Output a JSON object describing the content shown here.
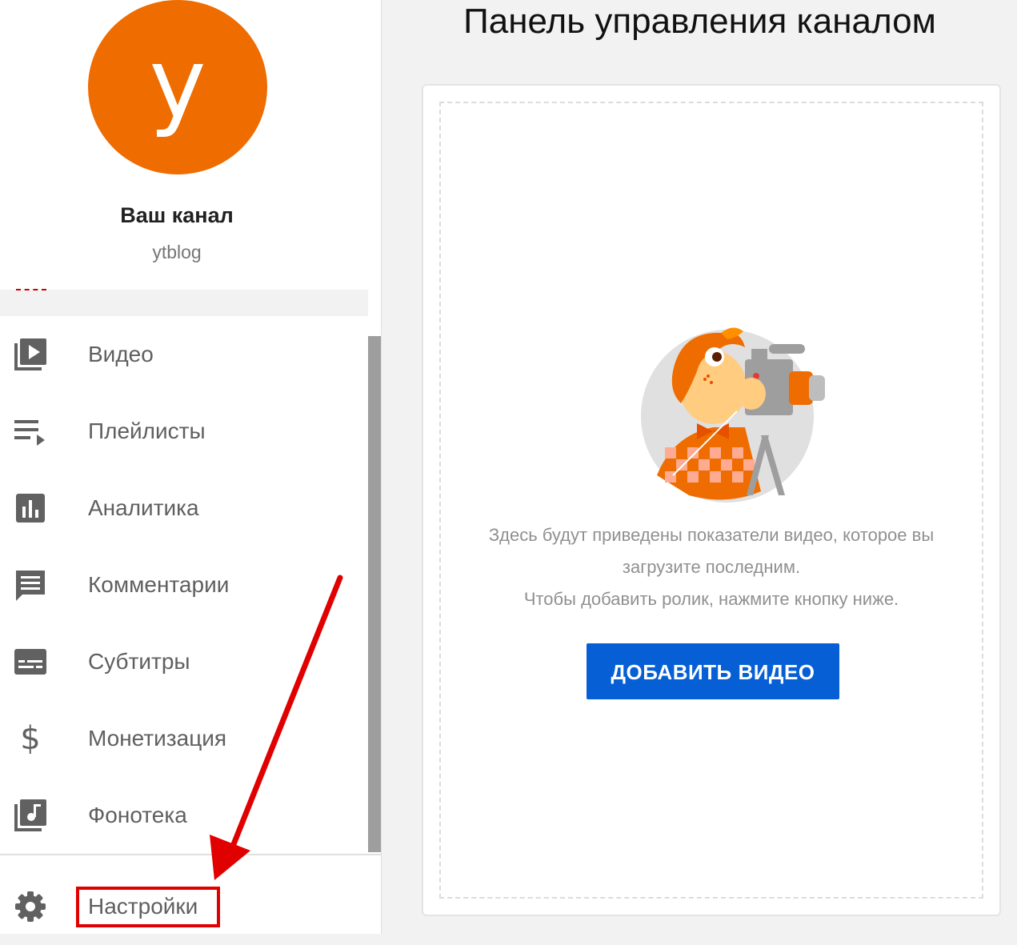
{
  "sidebar": {
    "avatar_letter": "у",
    "avatar_color": "#ef6c00",
    "channel_title": "Ваш канал",
    "channel_handle": "ytblog",
    "items": [
      {
        "label": "Видео",
        "icon": "video-library-icon"
      },
      {
        "label": "Плейлисты",
        "icon": "playlist-icon"
      },
      {
        "label": "Аналитика",
        "icon": "analytics-icon"
      },
      {
        "label": "Комментарии",
        "icon": "comments-icon"
      },
      {
        "label": "Субтитры",
        "icon": "subtitles-icon"
      },
      {
        "label": "Монетизация",
        "icon": "dollar-icon"
      },
      {
        "label": "Фонотека",
        "icon": "audio-library-icon"
      }
    ],
    "settings": {
      "label": "Настройки",
      "icon": "gear-icon"
    }
  },
  "main": {
    "title": "Панель управления каналом",
    "empty_text_line1": "Здесь будут приведены показатели видео, которое вы",
    "empty_text_line2": "загрузите последним.",
    "empty_text_line3": "Чтобы добавить ролик, нажмите кнопку ниже.",
    "add_video_label": "ДОБАВИТЬ ВИДЕО",
    "button_color": "#065fd4"
  },
  "annotation": {
    "highlight_color": "#e00000"
  }
}
